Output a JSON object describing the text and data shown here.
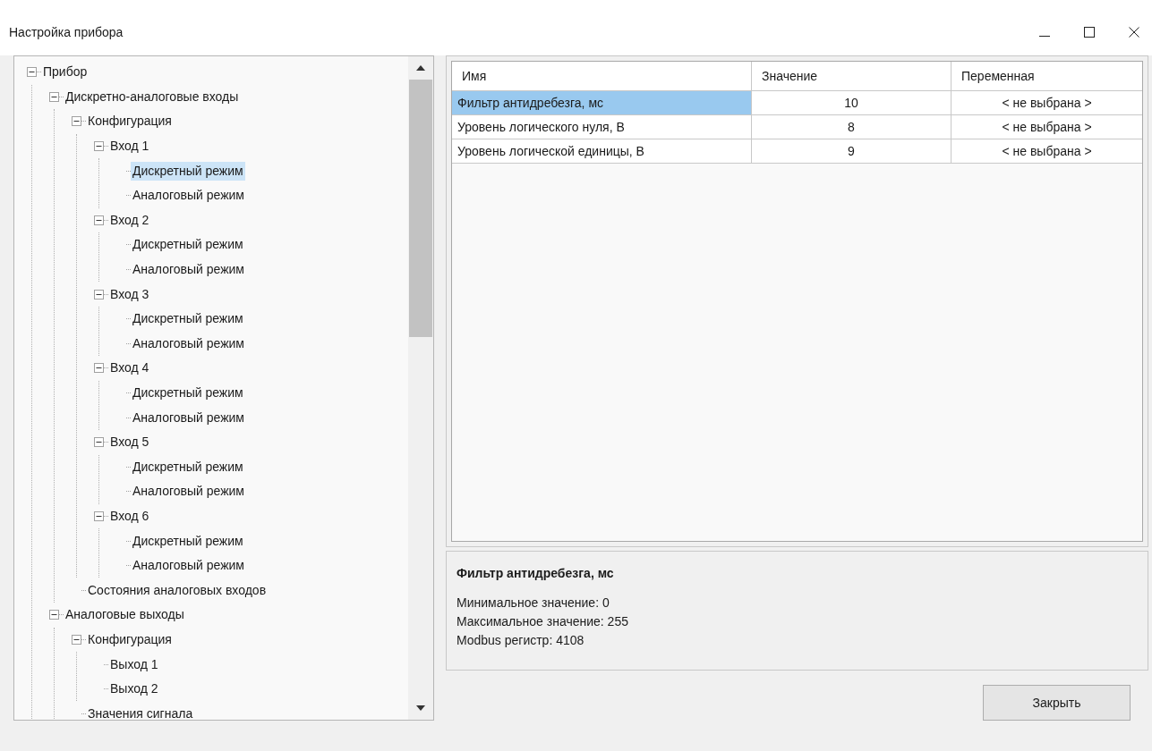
{
  "window": {
    "title": "Настройка прибора"
  },
  "tree": [
    {
      "label": "Прибор",
      "selected": false,
      "expanded": true,
      "children": [
        {
          "label": "Дискретно-аналоговые входы",
          "selected": false,
          "expanded": true,
          "children": [
            {
              "label": "Конфигурация",
              "selected": false,
              "expanded": true,
              "children": [
                {
                  "label": "Вход 1",
                  "selected": false,
                  "expanded": true,
                  "children": [
                    {
                      "label": "Дискретный режим",
                      "selected": true
                    },
                    {
                      "label": "Аналоговый режим",
                      "selected": false
                    }
                  ]
                },
                {
                  "label": "Вход 2",
                  "selected": false,
                  "expanded": true,
                  "children": [
                    {
                      "label": "Дискретный режим",
                      "selected": false
                    },
                    {
                      "label": "Аналоговый режим",
                      "selected": false
                    }
                  ]
                },
                {
                  "label": "Вход 3",
                  "selected": false,
                  "expanded": true,
                  "children": [
                    {
                      "label": "Дискретный режим",
                      "selected": false
                    },
                    {
                      "label": "Аналоговый режим",
                      "selected": false
                    }
                  ]
                },
                {
                  "label": "Вход 4",
                  "selected": false,
                  "expanded": true,
                  "children": [
                    {
                      "label": "Дискретный режим",
                      "selected": false
                    },
                    {
                      "label": "Аналоговый режим",
                      "selected": false
                    }
                  ]
                },
                {
                  "label": "Вход 5",
                  "selected": false,
                  "expanded": true,
                  "children": [
                    {
                      "label": "Дискретный режим",
                      "selected": false
                    },
                    {
                      "label": "Аналоговый режим",
                      "selected": false
                    }
                  ]
                },
                {
                  "label": "Вход 6",
                  "selected": false,
                  "expanded": true,
                  "children": [
                    {
                      "label": "Дискретный режим",
                      "selected": false
                    },
                    {
                      "label": "Аналоговый режим",
                      "selected": false
                    }
                  ]
                }
              ]
            },
            {
              "label": "Состояния аналоговых входов",
              "selected": false
            }
          ]
        },
        {
          "label": "Аналоговые выходы",
          "selected": false,
          "expanded": true,
          "children": [
            {
              "label": "Конфигурация",
              "selected": false,
              "expanded": true,
              "children": [
                {
                  "label": "Выход 1",
                  "selected": false
                },
                {
                  "label": "Выход 2",
                  "selected": false
                }
              ]
            },
            {
              "label": "Значения сигнала",
              "selected": false
            }
          ]
        }
      ]
    }
  ],
  "table": {
    "columns": [
      "Имя",
      "Значение",
      "Переменная"
    ],
    "rows": [
      {
        "name": "Фильтр антидребезга, мс",
        "value": "10",
        "variable": "< не выбрана >",
        "selected": true
      },
      {
        "name": "Уровень логического нуля, В",
        "value": "8",
        "variable": "< не выбрана >",
        "selected": false
      },
      {
        "name": "Уровень логической единицы, В",
        "value": "9",
        "variable": "< не выбрана >",
        "selected": false
      }
    ]
  },
  "details": {
    "title": "Фильтр антидребезга, мс",
    "lines": [
      "Минимальное значение: 0",
      "Максимальное значение: 255",
      "Modbus регистр: 4108"
    ]
  },
  "buttons": [
    "Закрыть"
  ]
}
